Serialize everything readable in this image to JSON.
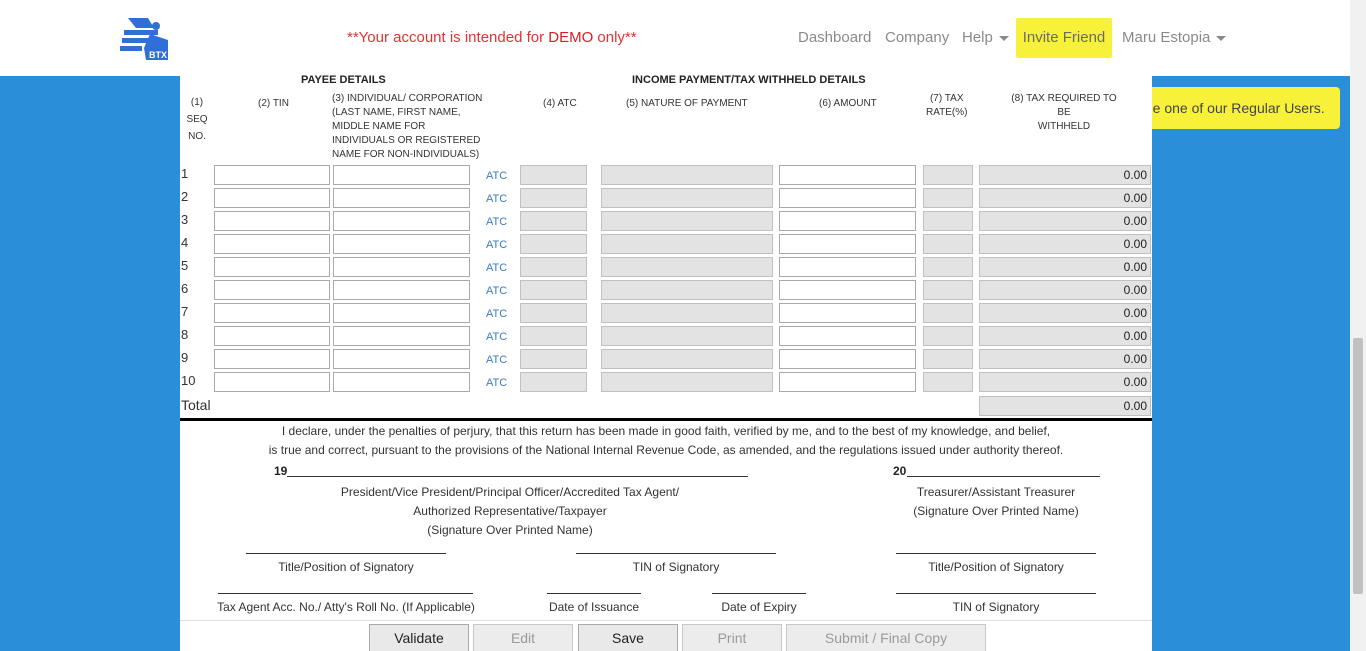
{
  "header": {
    "demo_prefix": "**Your account is intended for ",
    "demo_strong": "DEMO",
    "demo_suffix": " only**",
    "nav": {
      "dashboard": "Dashboard",
      "company": "Company",
      "help": "Help",
      "invite": "Invite Friend",
      "user": "Maru Estopia"
    }
  },
  "badge": "Be one of our Regular Users.",
  "form": {
    "payee_details": "PAYEE DETAILS",
    "income_details": "INCOME PAYMENT/TAX WITHHELD DETAILS",
    "col_seq": [
      "(1)",
      "SEQ",
      "NO."
    ],
    "col_tin": "(2) TIN",
    "col_name": [
      "(3) INDIVIDUAL/ CORPORATION",
      "(LAST NAME, FIRST NAME,",
      "MIDDLE NAME FOR",
      "INDIVIDUALS OR REGISTERED",
      "NAME FOR NON-INDIVIDUALS)"
    ],
    "col_atc": "(4) ATC",
    "col_nature": "(5) NATURE OF PAYMENT",
    "col_amount": "(6) AMOUNT",
    "col_rate": [
      "(7) TAX",
      "RATE(%)"
    ],
    "col_tax": [
      "(8) TAX REQUIRED TO BE",
      "WITHHELD"
    ],
    "atc_link": "ATC",
    "rows": [
      {
        "n": "1",
        "tax": "0.00"
      },
      {
        "n": "2",
        "tax": "0.00"
      },
      {
        "n": "3",
        "tax": "0.00"
      },
      {
        "n": "4",
        "tax": "0.00"
      },
      {
        "n": "5",
        "tax": "0.00"
      },
      {
        "n": "6",
        "tax": "0.00"
      },
      {
        "n": "7",
        "tax": "0.00"
      },
      {
        "n": "8",
        "tax": "0.00"
      },
      {
        "n": "9",
        "tax": "0.00"
      },
      {
        "n": "10",
        "tax": "0.00"
      }
    ],
    "total_label": "Total",
    "total_value": "0.00"
  },
  "declaration": {
    "line1": "I declare, under the penalties of perjury, that this return has been made in good faith, verified by me, and to the best of my knowledge, and belief,",
    "line2": "is true and correct, pursuant to the provisions of the National Internal Revenue Code, as amended, and the regulations issued under authority thereof.",
    "num19": "19",
    "num20": "20",
    "sig1": [
      "President/Vice President/Principal Officer/Accredited Tax Agent/",
      "Authorized Representative/Taxpayer",
      "(Signature Over Printed Name)"
    ],
    "sig2": [
      "Treasurer/Assistant Treasurer",
      "(Signature Over Printed Name)"
    ],
    "title_pos_1": "Title/Position of Signatory",
    "tin_sig_1": "TIN of Signatory",
    "title_pos_2": "Title/Position of Signatory",
    "tax_agent": "Tax Agent Acc. No./ Atty's Roll No. (If Applicable)",
    "date_issuance": "Date of Issuance",
    "date_expiry": "Date of Expiry",
    "tin_sig_2": "TIN of Signatory"
  },
  "buttons": {
    "validate": "Validate",
    "edit": "Edit",
    "save": "Save",
    "print": "Print",
    "submit": "Submit / Final Copy"
  }
}
